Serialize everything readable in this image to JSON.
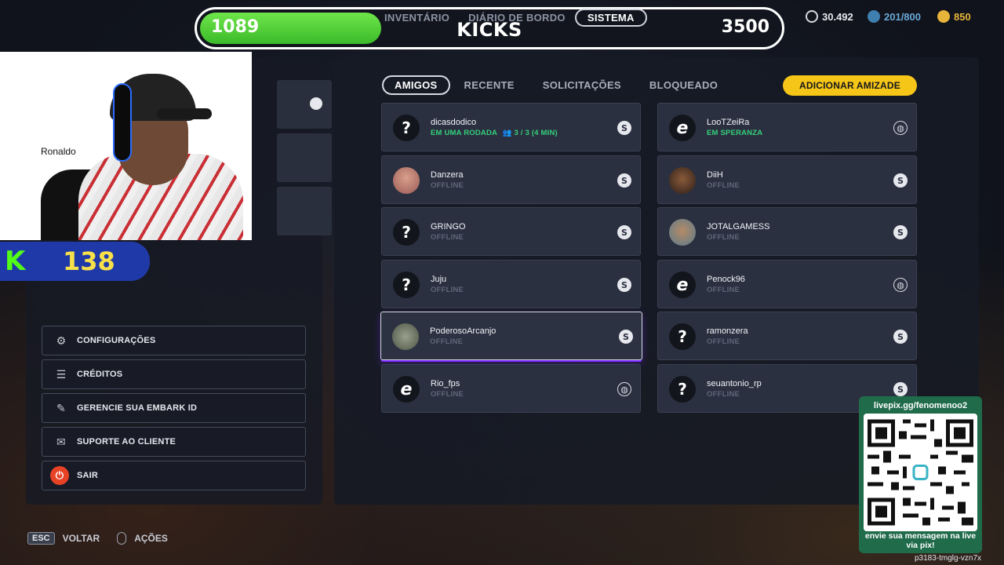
{
  "header": {
    "kicks_left": "1089",
    "kicks_title": "KICKS",
    "kicks_right": "3500",
    "kicks_progress": 0.31,
    "nav": [
      "INVENTÁRIO",
      "DIÁRIO DE BORDO",
      "SISTEMA"
    ],
    "nav_active": "SISTEMA",
    "currencies": [
      {
        "icon": "coin-icon",
        "value": "30.492",
        "color": "#d7d9df"
      },
      {
        "icon": "token-icon",
        "value": "201/800",
        "color": "#6aa9d9"
      },
      {
        "icon": "wheat-icon",
        "value": "850",
        "color": "#e7b43a"
      }
    ]
  },
  "webcam": {
    "name_text": "Ronaldo",
    "kick_count": "138"
  },
  "menu": {
    "items": [
      {
        "label": "CONFIGURAÇÕES",
        "icon": "gear-icon"
      },
      {
        "label": "CRÉDITOS",
        "icon": "credits-icon"
      },
      {
        "label": "GERENCIE SUA EMBARK ID",
        "icon": "embark-icon"
      },
      {
        "label": "SUPORTE AO CLIENTE",
        "icon": "support-icon"
      },
      {
        "label": "SAIR",
        "icon": "power-icon"
      }
    ]
  },
  "friends": {
    "tabs": [
      "AMIGOS",
      "RECENTE",
      "SOLICITAÇÕES",
      "BLOQUEADO"
    ],
    "active_tab": "AMIGOS",
    "add_button": "ADICIONAR AMIZADE",
    "left_column": [
      {
        "name": "dicasdodico",
        "status": "EM UMA RODADA",
        "party": "3 / 3 (4 MIN)",
        "online": true,
        "avatar": "unknown",
        "platform": "steam"
      },
      {
        "name": "Danzera",
        "status": "OFFLINE",
        "online": false,
        "avatar": "photo1",
        "platform": "steam"
      },
      {
        "name": "GRINGO",
        "status": "OFFLINE",
        "online": false,
        "avatar": "unknown",
        "platform": "steam"
      },
      {
        "name": "Juju",
        "status": "OFFLINE",
        "online": false,
        "avatar": "unknown",
        "platform": "steam"
      },
      {
        "name": "PoderosoArcanjo",
        "status": "OFFLINE",
        "online": false,
        "avatar": "photo4",
        "platform": "steam",
        "highlight": true
      },
      {
        "name": "Rio_fps",
        "status": "OFFLINE",
        "online": false,
        "avatar": "logo",
        "platform": "globe"
      }
    ],
    "right_column": [
      {
        "name": "LooTZeiRa",
        "status": "EM SPERANZA",
        "online": true,
        "avatar": "logo",
        "platform": "globe"
      },
      {
        "name": "DiiH",
        "status": "OFFLINE",
        "online": false,
        "avatar": "photo2",
        "platform": "steam"
      },
      {
        "name": "JOTALGAMESS",
        "status": "OFFLINE",
        "online": false,
        "avatar": "photo3",
        "platform": "steam"
      },
      {
        "name": "Penock96",
        "status": "OFFLINE",
        "online": false,
        "avatar": "logo",
        "platform": "globe"
      },
      {
        "name": "ramonzera",
        "status": "OFFLINE",
        "online": false,
        "avatar": "unknown",
        "platform": "steam"
      },
      {
        "name": "seuantonio_rp",
        "status": "OFFLINE",
        "online": false,
        "avatar": "unknown",
        "platform": "steam"
      }
    ]
  },
  "bottom": {
    "esc_key": "ESC",
    "back_label": "VOLTAR",
    "actions_label": "AÇÕES"
  },
  "livepix": {
    "url": "livepix.gg/fenomenoo2",
    "message": "envie sua mensagem na live via pix!",
    "code": "p3183-tmglg-vzn7x"
  }
}
